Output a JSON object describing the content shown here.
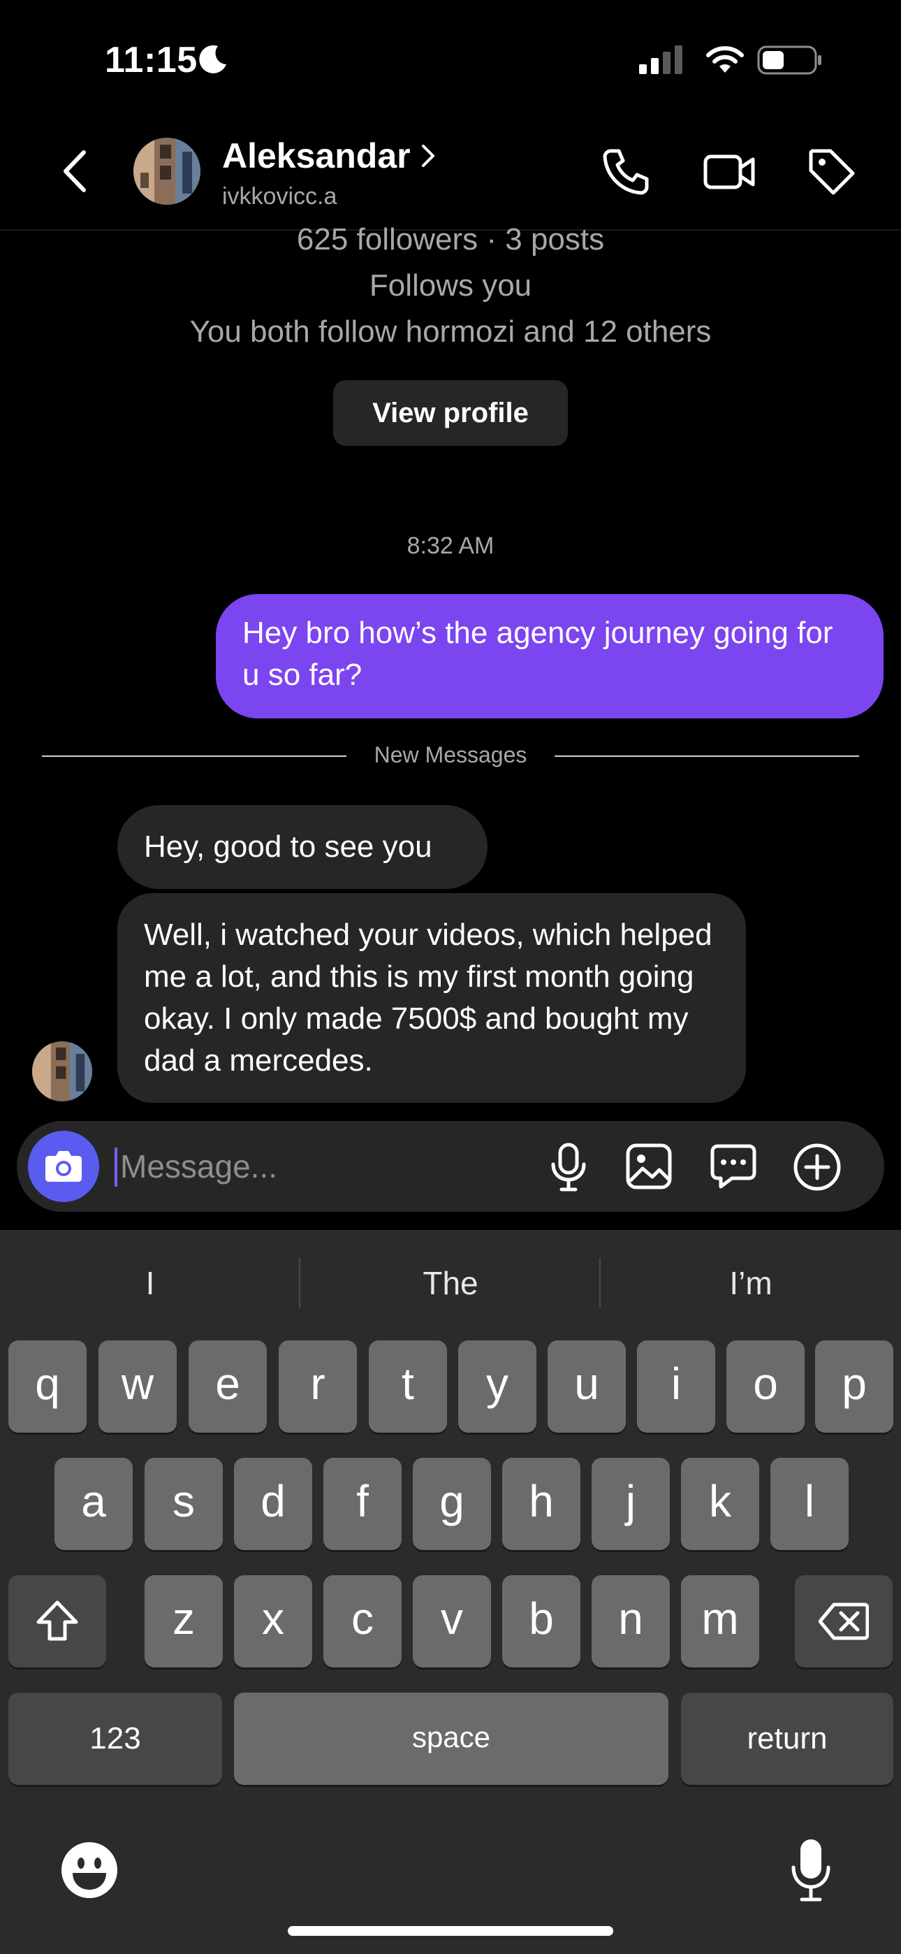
{
  "status_bar": {
    "time": "11:15"
  },
  "header": {
    "name": "Aleksandar",
    "username": "ivkkovicc.a"
  },
  "profile_info": {
    "followers_posts": "625 followers · 3 posts",
    "follows_you": "Follows you",
    "mutual": "You both follow hormozi and 12 others",
    "view_profile": "View profile"
  },
  "conversation": {
    "timestamp": "8:32 AM",
    "outgoing": [
      {
        "text": "Hey bro how’s the agency journey going for u so far?"
      }
    ],
    "new_messages_label": "New Messages",
    "incoming": [
      {
        "text": "Hey, good to see you"
      },
      {
        "text": "Well, i watched your videos, which helped me a lot, and this is my first month going okay. I only made 7500$ and bought my dad a mercedes."
      }
    ]
  },
  "composer": {
    "placeholder": "Message..."
  },
  "keyboard": {
    "suggestions": [
      "I",
      "The",
      "I’m"
    ],
    "row1": [
      "q",
      "w",
      "e",
      "r",
      "t",
      "y",
      "u",
      "i",
      "o",
      "p"
    ],
    "row2": [
      "a",
      "s",
      "d",
      "f",
      "g",
      "h",
      "j",
      "k",
      "l"
    ],
    "row3": [
      "z",
      "x",
      "c",
      "v",
      "b",
      "n",
      "m"
    ],
    "numbers_label": "123",
    "space_label": "space",
    "return_label": "return"
  },
  "colors": {
    "outgoing_bubble": "#7b45f0",
    "incoming_bubble": "#262626",
    "camera_button": "#5a5cf0"
  }
}
